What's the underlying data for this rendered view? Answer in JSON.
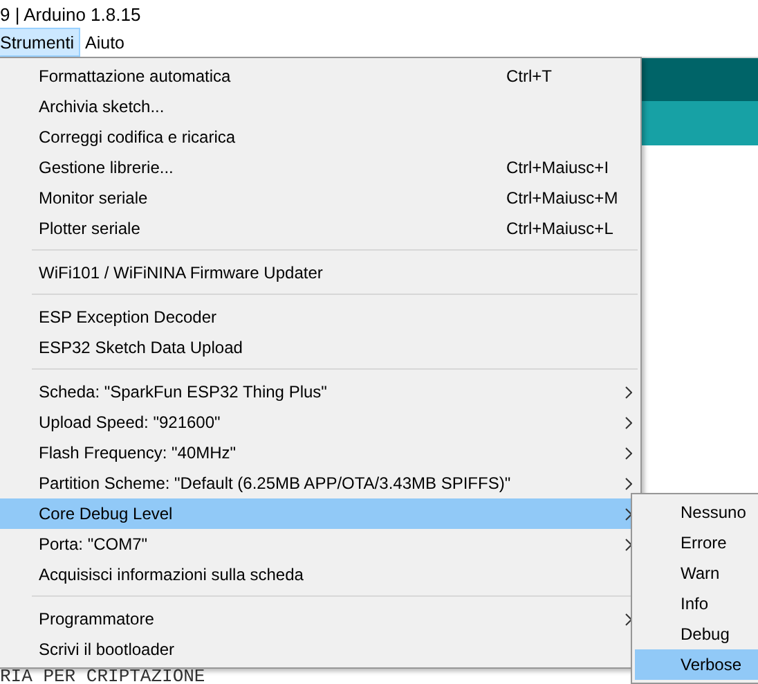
{
  "window": {
    "title": "9 | Arduino 1.8.15"
  },
  "menubar": [
    {
      "label": "Strumenti",
      "selected": true
    },
    {
      "label": "Aiuto",
      "selected": false
    }
  ],
  "editor": {
    "code_line": "RIA PER CRIPTAZIONE"
  },
  "menu": {
    "sections": [
      [
        {
          "label": "Formattazione automatica",
          "shortcut": "Ctrl+T",
          "has_submenu": false,
          "selected": false
        },
        {
          "label": "Archivia sketch...",
          "has_submenu": false,
          "selected": false
        },
        {
          "label": "Correggi codifica e ricarica",
          "has_submenu": false,
          "selected": false
        },
        {
          "label": "Gestione librerie...",
          "shortcut": "Ctrl+Maiusc+I",
          "has_submenu": false,
          "selected": false
        },
        {
          "label": "Monitor seriale",
          "shortcut": "Ctrl+Maiusc+M",
          "has_submenu": false,
          "selected": false
        },
        {
          "label": "Plotter seriale",
          "shortcut": "Ctrl+Maiusc+L",
          "has_submenu": false,
          "selected": false
        }
      ],
      [
        {
          "label": "WiFi101 / WiFiNINA Firmware Updater",
          "has_submenu": false,
          "selected": false
        }
      ],
      [
        {
          "label": "ESP Exception Decoder",
          "has_submenu": false,
          "selected": false
        },
        {
          "label": "ESP32 Sketch Data Upload",
          "has_submenu": false,
          "selected": false
        }
      ],
      [
        {
          "label": "Scheda: \"SparkFun ESP32 Thing Plus\"",
          "has_submenu": true,
          "selected": false
        },
        {
          "label": "Upload Speed: \"921600\"",
          "has_submenu": true,
          "selected": false
        },
        {
          "label": "Flash Frequency: \"40MHz\"",
          "has_submenu": true,
          "selected": false
        },
        {
          "label": "Partition Scheme: \"Default (6.25MB APP/OTA/3.43MB SPIFFS)\"",
          "has_submenu": true,
          "selected": false
        },
        {
          "label": "Core Debug Level",
          "has_submenu": true,
          "selected": true
        },
        {
          "label": "Porta: \"COM7\"",
          "has_submenu": true,
          "selected": false
        },
        {
          "label": "Acquisisci informazioni sulla scheda",
          "has_submenu": false,
          "selected": false
        }
      ],
      [
        {
          "label": "Programmatore",
          "has_submenu": true,
          "selected": false
        },
        {
          "label": "Scrivi il bootloader",
          "has_submenu": false,
          "selected": false
        }
      ]
    ]
  },
  "submenu": {
    "items": [
      {
        "label": "Nessuno",
        "selected": false
      },
      {
        "label": "Errore",
        "selected": false
      },
      {
        "label": "Warn",
        "selected": false
      },
      {
        "label": "Info",
        "selected": false
      },
      {
        "label": "Debug",
        "selected": false
      },
      {
        "label": "Verbose",
        "selected": true
      }
    ]
  }
}
